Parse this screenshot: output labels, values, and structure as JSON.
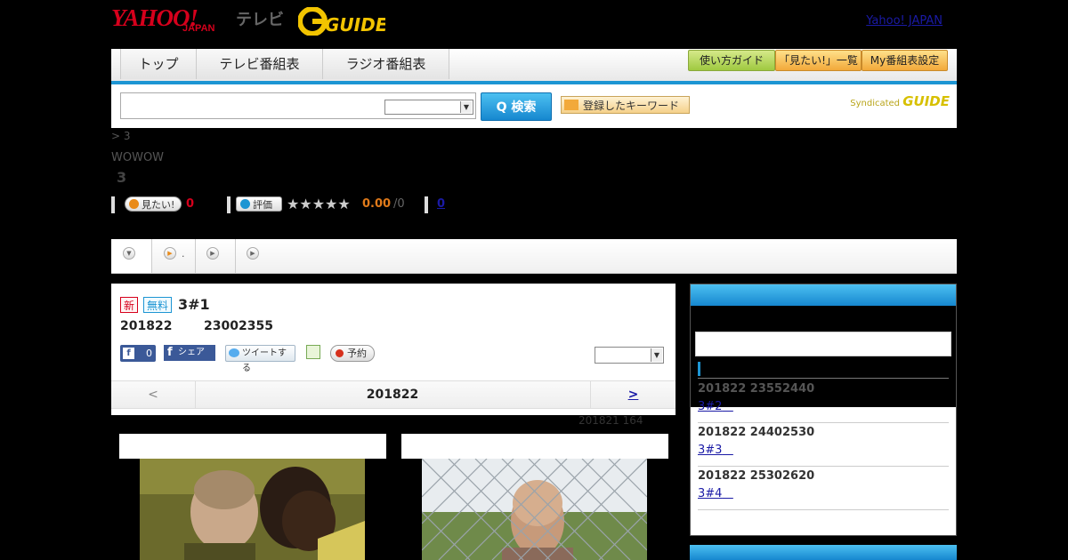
{
  "header": {
    "logo_yahoo": "YAHOO!",
    "logo_japan": "JAPAN",
    "logo_tv": "テレビ",
    "logo_guide": "GUIDE",
    "yahoo_link": "Yahoo! JAPAN"
  },
  "nav": {
    "tabs": [
      {
        "label": "トップ"
      },
      {
        "label": "テレビ番組表"
      },
      {
        "label": "ラジオ番組表"
      }
    ],
    "buttons": [
      {
        "label": "使い方ガイド"
      },
      {
        "label": "「見たい!」一覧"
      },
      {
        "label": "My番組表設定"
      }
    ]
  },
  "search": {
    "placeholder": "",
    "button_label": "Q 検索",
    "keyword_button_label": "登録したキーワード",
    "syndicated_label": "Syndicated",
    "syndicated_logo": "GUIDE"
  },
  "page": {
    "breadcrumb": "> 3",
    "channel": "WOWOW",
    "title": "3",
    "want_label": "見たい!",
    "want_count": "0",
    "rate_label": "評価",
    "rating_value": "0.00",
    "rating_count": "/0",
    "comment_count": "0"
  },
  "episode": {
    "badge_new": "新",
    "badge_free": "無料",
    "title": "3#1",
    "date": "201822",
    "time": "23002355",
    "fb_like_count": "0",
    "fb_share_label": "シェア",
    "tweet_label": "ツイートする",
    "reserve_label": "予約",
    "pager_prev": "<",
    "pager_current": "201822",
    "pager_next": ">",
    "note": "201821  164"
  },
  "sidebar": {
    "items": [
      {
        "date": "201822  23552440",
        "link": "3#2"
      },
      {
        "date": "201822  24402530",
        "link": "3#3"
      },
      {
        "date": "201822  25302620",
        "link": "3#4"
      }
    ]
  },
  "colors": {
    "accent_blue": "#1d95d3",
    "brand_red": "#d6001c",
    "link": "#1a1aa6"
  }
}
